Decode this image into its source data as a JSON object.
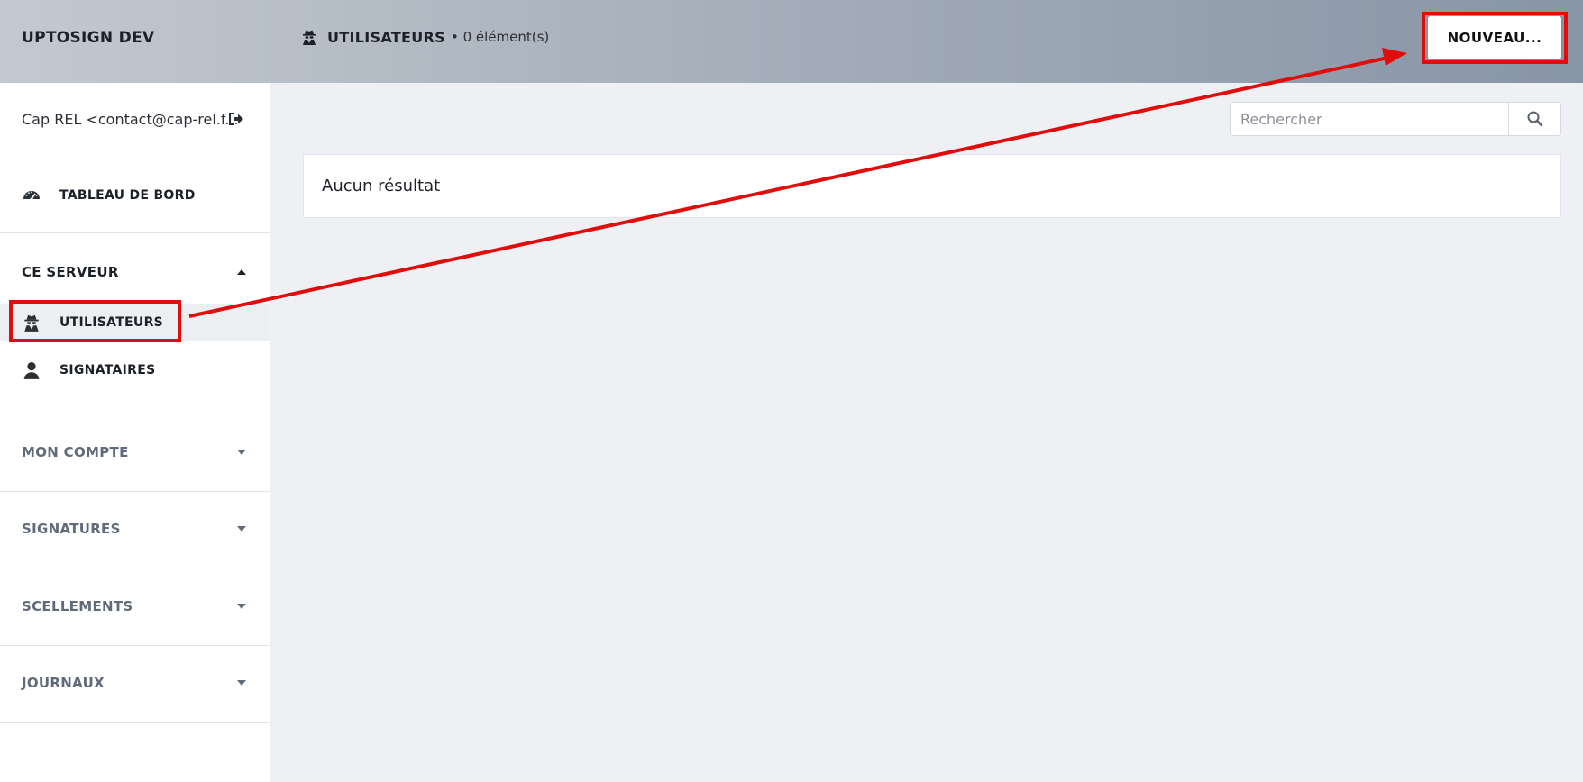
{
  "header": {
    "app_title": "UPTOSIGN DEV",
    "page_title": "UTILISATEURS",
    "page_count": "• 0 élément(s)",
    "new_button": "NOUVEAU..."
  },
  "sidebar": {
    "user_label": "Cap REL <contact@cap-rel.f...",
    "dashboard": "TABLEAU DE BORD",
    "sections": {
      "server": "CE SERVEUR",
      "account": "MON COMPTE",
      "signatures": "SIGNATURES",
      "seals": "SCELLEMENTS",
      "logs": "JOURNAUX"
    },
    "server_items": {
      "users": "UTILISATEURS",
      "signers": "SIGNATAIRES"
    }
  },
  "search": {
    "placeholder": "Rechercher"
  },
  "main": {
    "empty_text": "Aucun résultat"
  },
  "colors": {
    "highlight": "#e10c0c",
    "section_active": "#1c2027",
    "section_inactive": "#5f6a7a"
  },
  "icons": {
    "dashboard": "tachometer-icon",
    "users": "user-secret-icon",
    "signers": "user-icon",
    "logout": "sign-out-icon",
    "search": "search-icon"
  }
}
